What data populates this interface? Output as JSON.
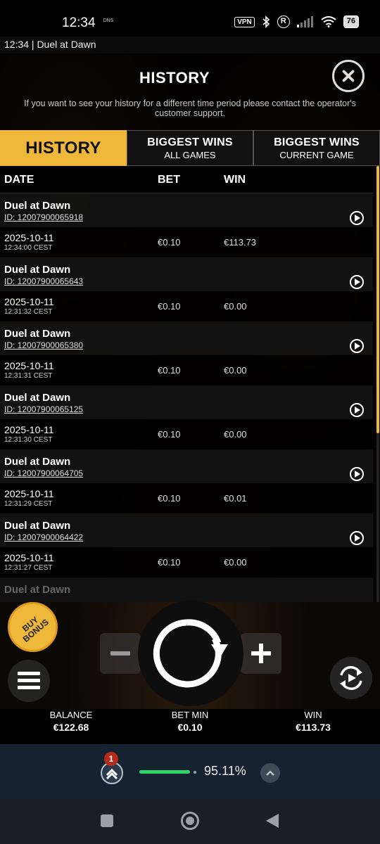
{
  "status_bar": {
    "time": "12:34",
    "dns_label": "DNS",
    "vpn_label": "VPN",
    "r_label": "R",
    "battery": "76"
  },
  "top_bar": {
    "text": "12:34  |  Duel at Dawn"
  },
  "modal": {
    "title": "HISTORY",
    "info": "If you want to see your history for a different time period please contact the operator's customer support.",
    "tabs": [
      {
        "main": "HISTORY",
        "sub": ""
      },
      {
        "main": "BIGGEST WINS",
        "sub": "ALL GAMES"
      },
      {
        "main": "BIGGEST WINS",
        "sub": "CURRENT GAME"
      }
    ],
    "columns": {
      "date": "DATE",
      "bet": "BET",
      "win": "WIN"
    },
    "entries": [
      {
        "game": "Duel at Dawn",
        "id": "ID: 12007900065918",
        "date": "2025-10-11",
        "time": "12:34:00 CEST",
        "bet": "€0.10",
        "win": "€113.73"
      },
      {
        "game": "Duel at Dawn",
        "id": "ID: 12007900065643",
        "date": "2025-10-11",
        "time": "12:31:32 CEST",
        "bet": "€0.10",
        "win": "€0.00"
      },
      {
        "game": "Duel at Dawn",
        "id": "ID: 12007900065380",
        "date": "2025-10-11",
        "time": "12:31:31 CEST",
        "bet": "€0.10",
        "win": "€0.00"
      },
      {
        "game": "Duel at Dawn",
        "id": "ID: 12007900065125",
        "date": "2025-10-11",
        "time": "12:31:30 CEST",
        "bet": "€0.10",
        "win": "€0.00"
      },
      {
        "game": "Duel at Dawn",
        "id": "ID: 12007900064705",
        "date": "2025-10-11",
        "time": "12:31:29 CEST",
        "bet": "€0.10",
        "win": "€0.01"
      },
      {
        "game": "Duel at Dawn",
        "id": "ID: 12007900064422",
        "date": "2025-10-11",
        "time": "12:31:27 CEST",
        "bet": "€0.10",
        "win": "€0.00"
      },
      {
        "game": "Duel at Dawn"
      }
    ]
  },
  "controls": {
    "buy_bonus": "BUY BONUS",
    "balance_label": "BALANCE",
    "balance_value": "€122.68",
    "bet_label": "BET MIN",
    "bet_value": "€0.10",
    "win_label": "WIN",
    "win_value": "€113.73"
  },
  "rtp_bar": {
    "badge": "1",
    "value": "95.11%"
  },
  "icons": {
    "close": "close-icon",
    "play": "play-icon",
    "spin": "spin-icon",
    "autoplay": "autoplay-icon",
    "menu": "menu-icon"
  },
  "colors": {
    "accent": "#f0b83a",
    "rtp_green": "#2fd46a",
    "badge_red": "#b62a1a"
  }
}
